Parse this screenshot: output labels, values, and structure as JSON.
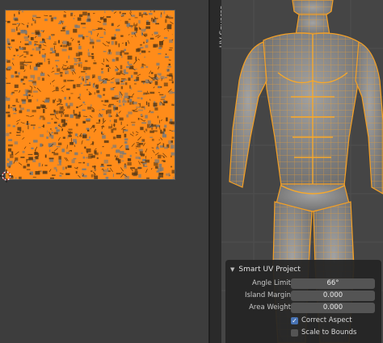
{
  "sidebar_tab": {
    "label": "UV Squares"
  },
  "operator_panel": {
    "title": "Smart UV Project",
    "fields": [
      {
        "label": "Angle Limit",
        "value": "66°"
      },
      {
        "label": "Island Margin",
        "value": "0.000"
      },
      {
        "label": "Area Weight",
        "value": "0.000"
      }
    ],
    "checkboxes": [
      {
        "label": "Correct Aspect",
        "checked": true
      },
      {
        "label": "Scale to Bounds",
        "checked": false
      }
    ]
  },
  "colors": {
    "uv_selected": "#ff8c1a",
    "mesh_wire": "#f5a024",
    "mesh_surface": "#8c8c8c",
    "background": "#3d3d3d",
    "checkbox_active": "#4772b3"
  }
}
